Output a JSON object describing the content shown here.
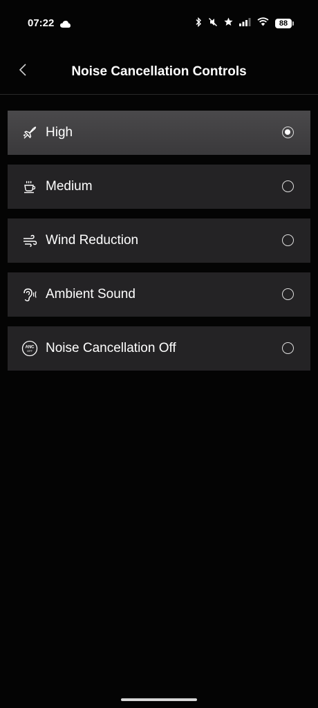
{
  "status_bar": {
    "time": "07:22",
    "battery": "88",
    "icons": [
      "cloud-icon",
      "bluetooth-icon",
      "mute-icon",
      "star-icon",
      "signal-icon",
      "wifi-icon",
      "battery-icon"
    ]
  },
  "header": {
    "title": "Noise Cancellation Controls",
    "back_icon": "chevron-left-icon"
  },
  "options": [
    {
      "label": "High",
      "icon": "airplane-icon",
      "selected": true
    },
    {
      "label": "Medium",
      "icon": "coffee-cup-icon",
      "selected": false
    },
    {
      "label": "Wind Reduction",
      "icon": "wind-icon",
      "selected": false
    },
    {
      "label": "Ambient Sound",
      "icon": "ear-icon",
      "selected": false
    },
    {
      "label": "Noise Cancellation Off",
      "icon": "anc-off-icon",
      "selected": false
    }
  ],
  "anc_icon_text": {
    "top": "ANC",
    "bottom": "OFF"
  },
  "colors": {
    "background": "#040404",
    "row": "#242325",
    "row_selected": "#434244",
    "text": "#ffffff"
  }
}
